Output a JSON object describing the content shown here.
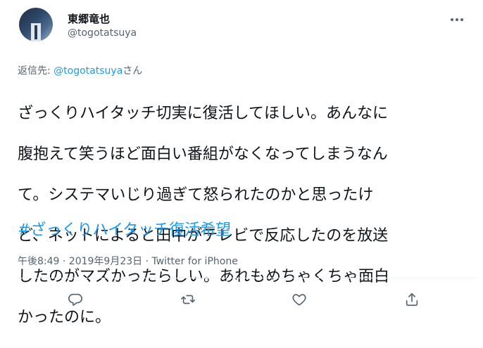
{
  "user": {
    "name": "東郷竜也",
    "handle": "@togotatsuya"
  },
  "reply": {
    "prefix": "返信先: ",
    "mention": "@togotatsuya",
    "suffix": "さん"
  },
  "tweet": {
    "lines": [
      "ざっくりハイタッチ切実に復活してほしい。あんなに",
      "腹抱えて笑うほど面白い番組がなくなってしまうなん",
      "て。システマいじり過ぎて怒られたのかと思ったけ",
      "ど、ネットによると田中がテレビで反応したのを放送",
      "したのがマズかったらしい。あれもめちゃくちゃ面白",
      "かったのに。"
    ],
    "hashtag": "#ざっくりハイタッチ復活希望",
    "timestamp": "午後8:49 · 2019年9月23日 · Twitter for iPhone"
  },
  "colors": {
    "accent": "#1d9bf0",
    "secondary_text": "#536471",
    "primary_text": "#0f1419"
  },
  "icons": {
    "more": "more-horizontal-icon",
    "reply": "reply-icon",
    "retweet": "retweet-icon",
    "like": "heart-icon",
    "share": "share-icon"
  }
}
